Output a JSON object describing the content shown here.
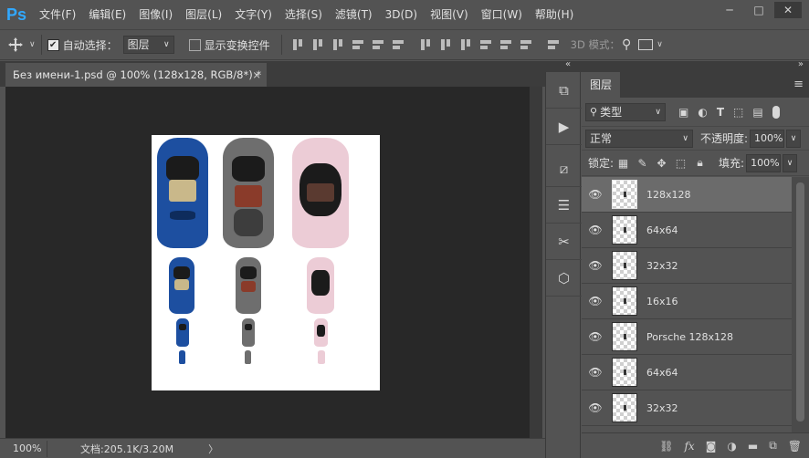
{
  "app": {
    "logo": "Ps"
  },
  "menu": [
    "文件(F)",
    "编辑(E)",
    "图像(I)",
    "图层(L)",
    "文字(Y)",
    "选择(S)",
    "滤镜(T)",
    "3D(D)",
    "视图(V)",
    "窗口(W)",
    "帮助(H)"
  ],
  "window_controls": {
    "minimize": "─",
    "maximize": "□",
    "close": "✕"
  },
  "options": {
    "auto_select_label": "自动选择：",
    "auto_select_checked": true,
    "auto_select_value": "图层",
    "show_transform_label": "显示变换控件",
    "show_transform_checked": false,
    "mode_label": "3D 模式："
  },
  "document": {
    "tab_title": "Без имени-1.psd @ 100% (128x128, RGB/8*) *",
    "tab_close": "×",
    "zoom": "100%",
    "doc_info": "文档:205.1K/3.20M",
    "arrow": "〉"
  },
  "layers_panel": {
    "tab": "图层",
    "filter_label": "类型",
    "blend_mode": "正常",
    "opacity_label": "不透明度:",
    "opacity_value": "100%",
    "lock_label": "锁定:",
    "fill_label": "填充:",
    "fill_value": "100%",
    "layers": [
      {
        "name": "128x128",
        "selected": true
      },
      {
        "name": "64x64",
        "selected": false
      },
      {
        "name": "32x32",
        "selected": false
      },
      {
        "name": "16x16",
        "selected": false
      },
      {
        "name": "Porsche 128x128",
        "selected": false
      },
      {
        "name": "64x64",
        "selected": false
      },
      {
        "name": "32x32",
        "selected": false
      }
    ]
  },
  "colors": {
    "ui_gray": "#535353",
    "canvas_dark": "#282828",
    "ps_blue": "#31a8ff",
    "car_blue": "#1d4fa0",
    "car_gray": "#6e6e6e",
    "car_pink": "#ecccd6"
  }
}
